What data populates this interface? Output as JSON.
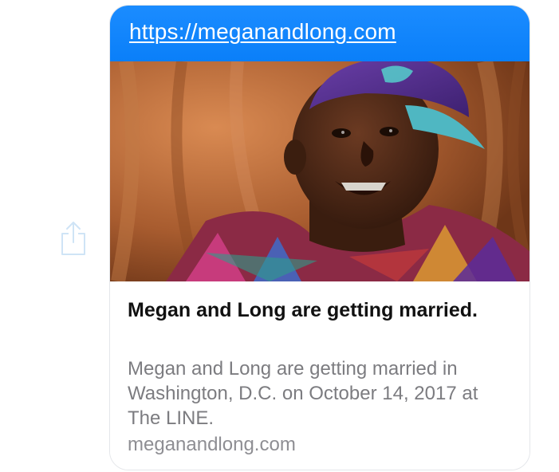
{
  "message": {
    "share_icon": "share-up-arrow-icon",
    "link_url": "https://meganandlong.com",
    "preview": {
      "image_alt": "",
      "title": "Megan and Long are getting married.",
      "description": "Megan and Long are getting married in Washington, D.C. on October 14, 2017 at The LINE.",
      "domain": "meganandlong.com"
    }
  },
  "colors": {
    "bubble_accent": "#0a84ff",
    "title_text": "#111111",
    "secondary_text": "#8e8e93",
    "share_icon": "#cfe4f6"
  }
}
